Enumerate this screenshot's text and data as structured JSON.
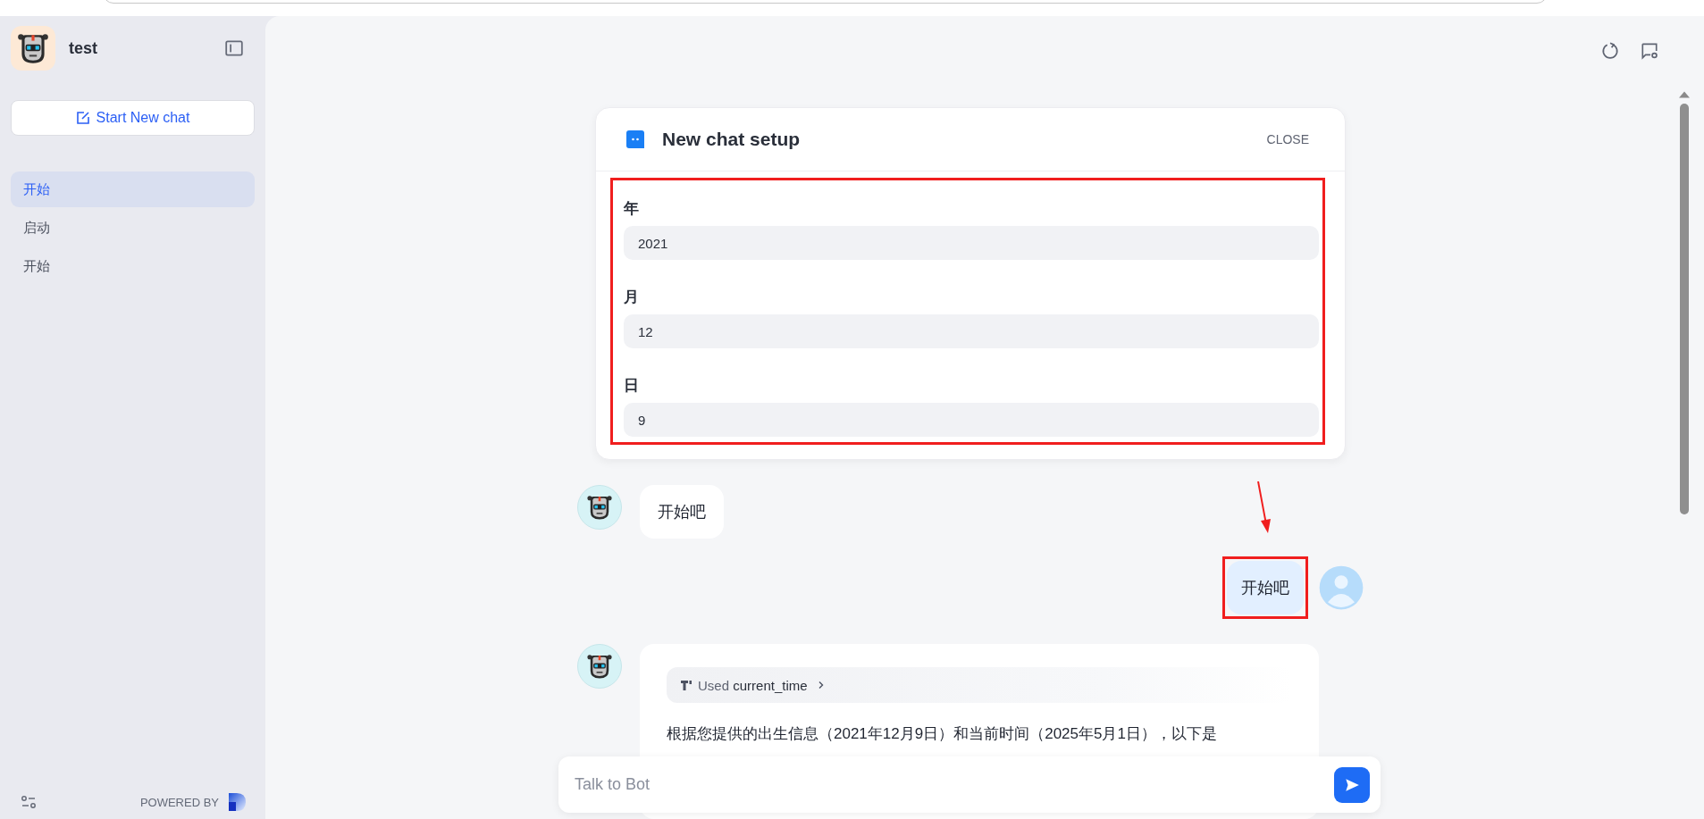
{
  "app": {
    "name": "test",
    "new_chat_label": "Start New chat",
    "powered_by": "POWERED BY"
  },
  "conversations": [
    {
      "title": "开始",
      "selected": true
    },
    {
      "title": "启动",
      "selected": false
    },
    {
      "title": "开始",
      "selected": false
    }
  ],
  "setup": {
    "title": "New chat setup",
    "close": "CLOSE",
    "highlighted": true,
    "fields": [
      {
        "label": "年",
        "value": "2021"
      },
      {
        "label": "月",
        "value": "12"
      },
      {
        "label": "日",
        "value": "9"
      }
    ]
  },
  "messages": [
    {
      "kind": "bot",
      "text": "开始吧"
    },
    {
      "kind": "user",
      "text": "开始吧",
      "highlighted": true
    },
    {
      "kind": "bot",
      "tool": {
        "prefix": "Used",
        "name": "current_time"
      },
      "text": "根据您提供的出生信息（2021年12月9日）和当前时间（2025年5月1日），以下是"
    }
  ],
  "input": {
    "placeholder": "Talk to Bot"
  }
}
